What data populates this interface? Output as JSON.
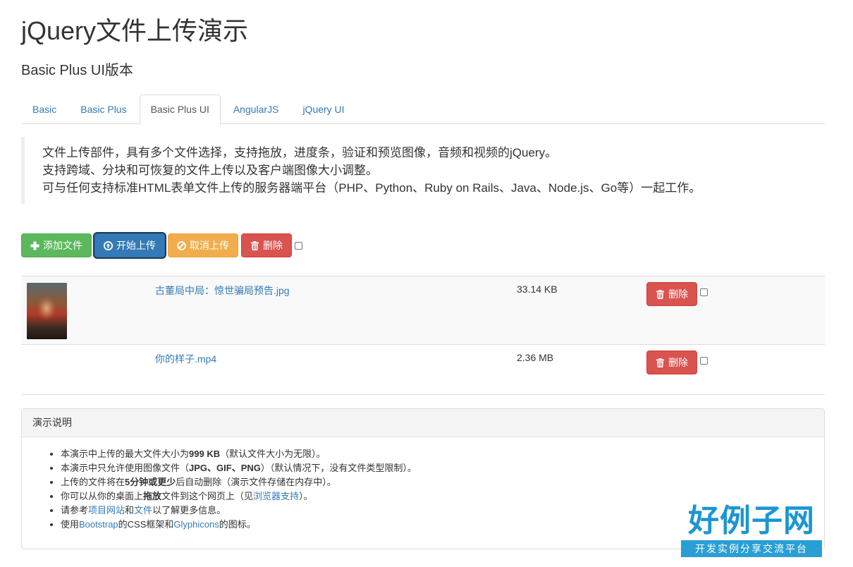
{
  "header": {
    "title": "jQuery文件上传演示",
    "subtitle": "Basic Plus UI版本"
  },
  "tabs": [
    {
      "label": "Basic",
      "active": false
    },
    {
      "label": "Basic Plus",
      "active": false
    },
    {
      "label": "Basic Plus UI",
      "active": true
    },
    {
      "label": "AngularJS",
      "active": false
    },
    {
      "label": "jQuery UI",
      "active": false
    }
  ],
  "intro": {
    "lines": [
      "文件上传部件，具有多个文件选择，支持拖放，进度条，验证和预览图像，音频和视频的jQuery。",
      "支持跨域、分块和可恢复的文件上传以及客户端图像大小调整。",
      "可与任何支持标准HTML表单文件上传的服务器端平台（PHP、Python、Ruby on Rails、Java、Node.js、Go等）一起工作。"
    ]
  },
  "toolbar": {
    "add_label": "添加文件",
    "start_label": "开始上传",
    "cancel_label": "取消上传",
    "delete_label": "删除"
  },
  "files": [
    {
      "name": "古董局中局：惊世骗局预告.jpg",
      "size": "33.14 KB",
      "delete_label": "删除"
    },
    {
      "name": "你的样子.mp4",
      "size": "2.36 MB",
      "delete_label": "删除"
    }
  ],
  "notes": {
    "heading": "演示说明",
    "items": [
      {
        "a": "本演示中上传的最大文件大小为",
        "b": "999 KB",
        "c": "（默认文件大小为无限）。"
      },
      {
        "a": "本演示中只允许使用图像文件（",
        "b": "JPG、GIF、PNG",
        "c": "）（默认情况下，没有文件类型限制）。"
      },
      {
        "a": "上传的文件将在",
        "b": "5分钟或更少",
        "c": "后自动删除（演示文件存储在内存中）。"
      },
      {
        "a": "你可以从你的桌面上",
        "b": "拖放",
        "c": "文件到这个网页上（见",
        "link": "浏览器支持",
        "d": "）。"
      },
      {
        "a": "请参考",
        "link1": "项目网站",
        "m": "和",
        "link2": "文件",
        "c": "以了解更多信息。"
      },
      {
        "a": "使用",
        "link1": "Bootstrap",
        "m": "的CSS框架和",
        "link2": "Glyphicons",
        "c": "的图标。"
      }
    ]
  },
  "watermark": {
    "big": "好例子网",
    "small": "开发实例分享交流平台"
  },
  "colors": {
    "link": "#337ab7",
    "success": "#5cb85c",
    "primary": "#337ab7",
    "warning": "#f0ad4e",
    "danger": "#d9534f"
  }
}
